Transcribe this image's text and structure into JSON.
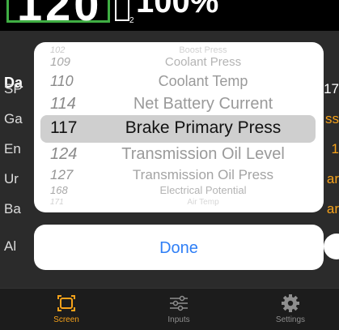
{
  "gauge": {
    "big_value": "120",
    "subscript": "2",
    "percent": "100%"
  },
  "background": {
    "header": "Da",
    "rows": [
      {
        "label": "SP",
        "value": "17"
      },
      {
        "label": "Ga",
        "value": "ss"
      },
      {
        "label": "En",
        "value": "1"
      },
      {
        "label": "Ur",
        "value": "ar"
      },
      {
        "label": "Ba",
        "value": "ar"
      },
      {
        "label": "Al",
        "value": ""
      }
    ]
  },
  "picker": {
    "rows": [
      {
        "num": "102",
        "name": "Boost Press"
      },
      {
        "num": "109",
        "name": "Coolant Press"
      },
      {
        "num": "110",
        "name": "Coolant Temp"
      },
      {
        "num": "114",
        "name": "Net Battery Current"
      },
      {
        "num": "117",
        "name": "Brake Primary Press"
      },
      {
        "num": "124",
        "name": "Transmission Oil Level"
      },
      {
        "num": "127",
        "name": "Transmission Oil Press"
      },
      {
        "num": "168",
        "name": "Electrical Potential"
      },
      {
        "num": "171",
        "name": "Air Temp"
      }
    ],
    "selected_index": 4
  },
  "done_label": "Done",
  "tabs": [
    {
      "label": "Screen",
      "icon": "screen-icon",
      "active": true
    },
    {
      "label": "Inputs",
      "icon": "sliders-icon",
      "active": false
    },
    {
      "label": "Settings",
      "icon": "gear-icon",
      "active": false
    }
  ],
  "colors": {
    "accent": "#f6a21a",
    "link": "#2f7ff6",
    "gauge_border": "#3fae43"
  }
}
